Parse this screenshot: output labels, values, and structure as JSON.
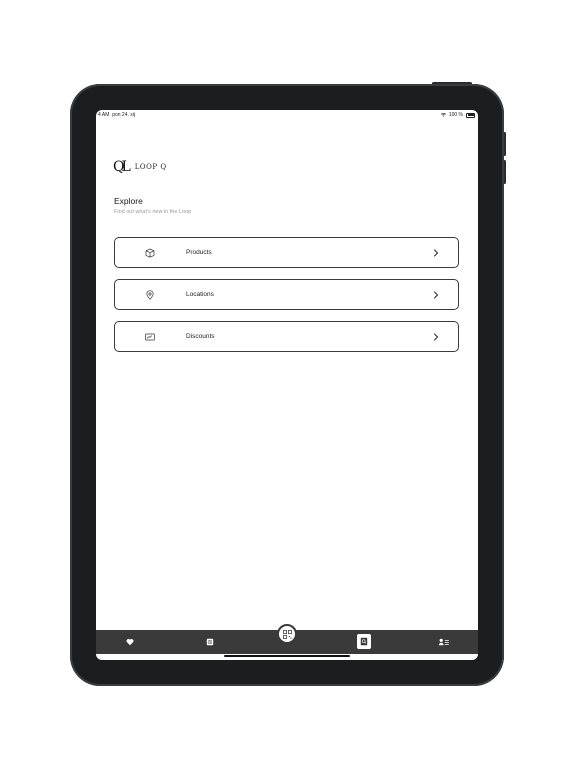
{
  "status_bar": {
    "time": "4 AM",
    "date": "pon 24. sij",
    "battery": "100 %"
  },
  "brand": {
    "mark": "QL",
    "name": "LOOP Q"
  },
  "header": {
    "title": "Explore",
    "subtitle": "Find out what's new in the Loop"
  },
  "menu": [
    {
      "label": "Products",
      "icon": "box-icon"
    },
    {
      "label": "Locations",
      "icon": "location-pin-icon"
    },
    {
      "label": "Discounts",
      "icon": "ticket-icon"
    }
  ],
  "tabs": [
    {
      "name": "favorites",
      "icon": "heart-icon"
    },
    {
      "name": "list",
      "icon": "list-icon"
    },
    {
      "name": "scan",
      "icon": "qr-code-icon"
    },
    {
      "name": "explore",
      "icon": "search-document-icon",
      "active": true
    },
    {
      "name": "profile",
      "icon": "profile-icon"
    }
  ],
  "colors": {
    "tabbar": "#3a3a3a",
    "device": "#1b1d1f",
    "card_border": "#3b3b3b"
  }
}
